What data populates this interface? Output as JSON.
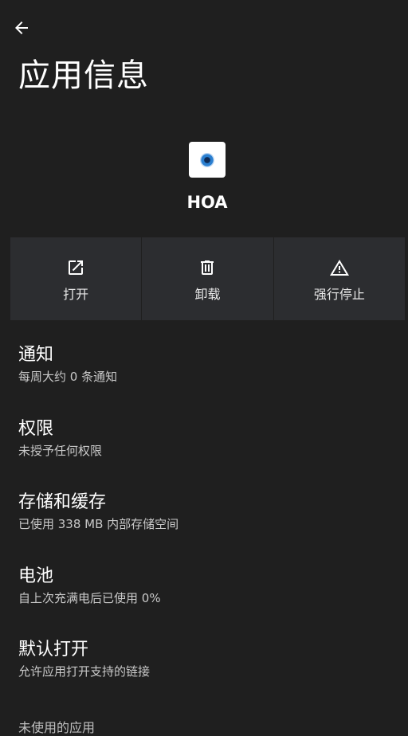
{
  "header": {
    "title": "应用信息"
  },
  "app": {
    "name": "HOA"
  },
  "actions": [
    {
      "label": "打开",
      "icon": "open-external-icon"
    },
    {
      "label": "卸载",
      "icon": "trash-icon"
    },
    {
      "label": "强行停止",
      "icon": "warning-icon"
    }
  ],
  "settings": [
    {
      "title": "通知",
      "subtitle": "每周大约 0 条通知"
    },
    {
      "title": "权限",
      "subtitle": "未授予任何权限"
    },
    {
      "title": "存储和缓存",
      "subtitle": "已使用 338 MB 内部存储空间"
    },
    {
      "title": "电池",
      "subtitle": "自上次充满电后已使用 0%"
    },
    {
      "title": "默认打开",
      "subtitle": "允许应用打开支持的链接"
    }
  ],
  "partial_item": {
    "title": "未使用的应用"
  },
  "colors": {
    "background": "#1f1f1f",
    "action_bg": "#2c2d30",
    "text": "#ffffff",
    "subtext": "#c9c9c9"
  }
}
